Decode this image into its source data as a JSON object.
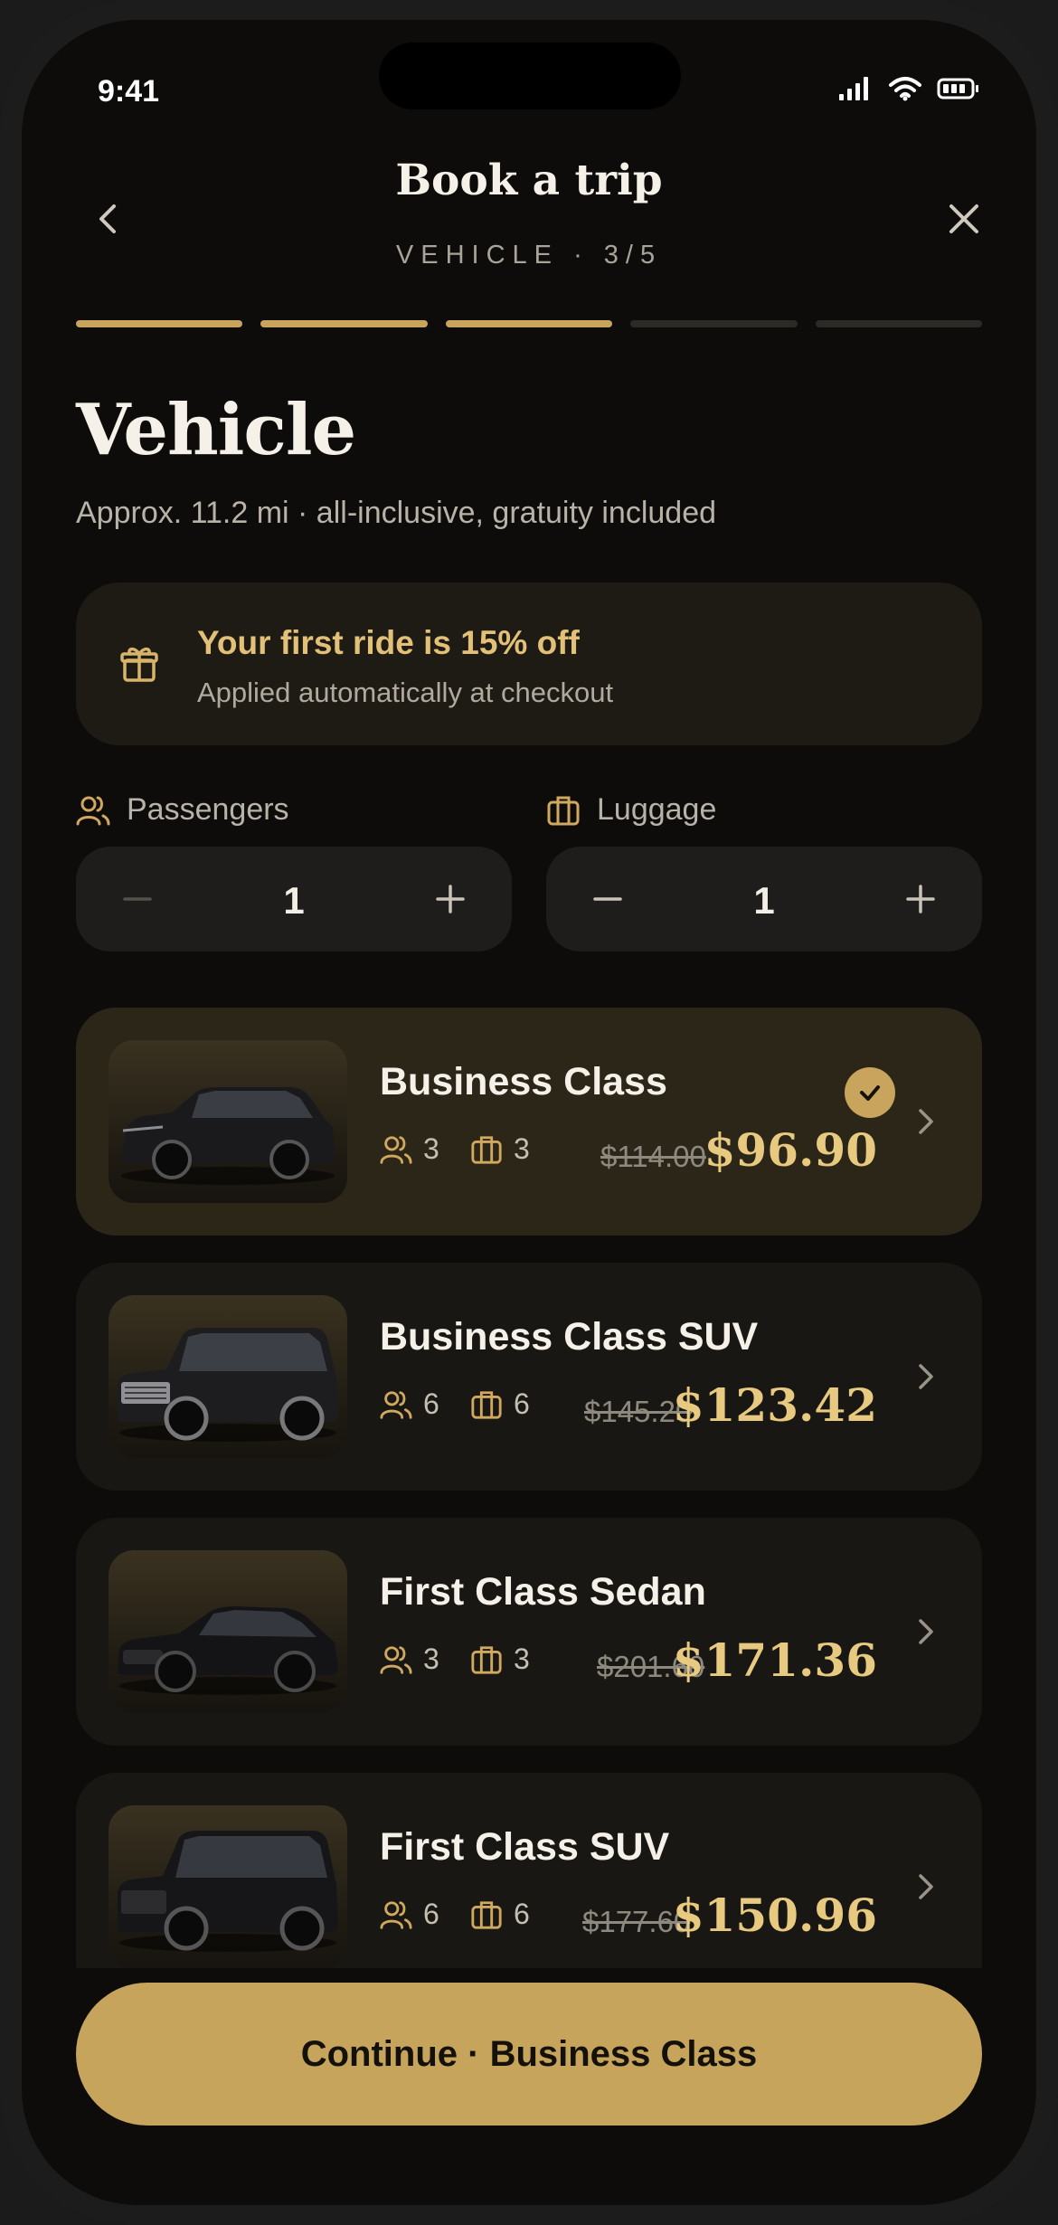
{
  "status_bar": {
    "time": "9:41"
  },
  "header": {
    "title": "Book a trip",
    "subtitle": "VEHICLE · 3/5",
    "progress": {
      "current": 3,
      "total": 5
    }
  },
  "page": {
    "title": "Vehicle",
    "subtitle": "Approx. 11.2 mi · all-inclusive, gratuity included"
  },
  "promo": {
    "title": "Your first ride is 15% off",
    "subtitle": "Applied automatically at checkout",
    "icon": "gift-icon"
  },
  "passengers": {
    "label": "Passengers",
    "value": "1"
  },
  "luggage": {
    "label": "Luggage",
    "value": "1"
  },
  "vehicles": [
    {
      "name": "Business Class",
      "passengers": "3",
      "bags": "3",
      "old_price": "$114.00",
      "price": "$96.90",
      "selected": true
    },
    {
      "name": "Business Class SUV",
      "passengers": "6",
      "bags": "6",
      "old_price": "$145.20",
      "price": "$123.42",
      "selected": false
    },
    {
      "name": "First Class Sedan",
      "passengers": "3",
      "bags": "3",
      "old_price": "$201.60",
      "price": "$171.36",
      "selected": false
    },
    {
      "name": "First Class SUV",
      "passengers": "6",
      "bags": "6",
      "old_price": "$177.60",
      "price": "$150.96",
      "selected": false
    }
  ],
  "cta": {
    "label": "Continue · Business Class"
  },
  "colors": {
    "accent": "#c8a45c",
    "background": "#0d0c0b",
    "card": "#191714",
    "card_selected": "#2c2618"
  }
}
